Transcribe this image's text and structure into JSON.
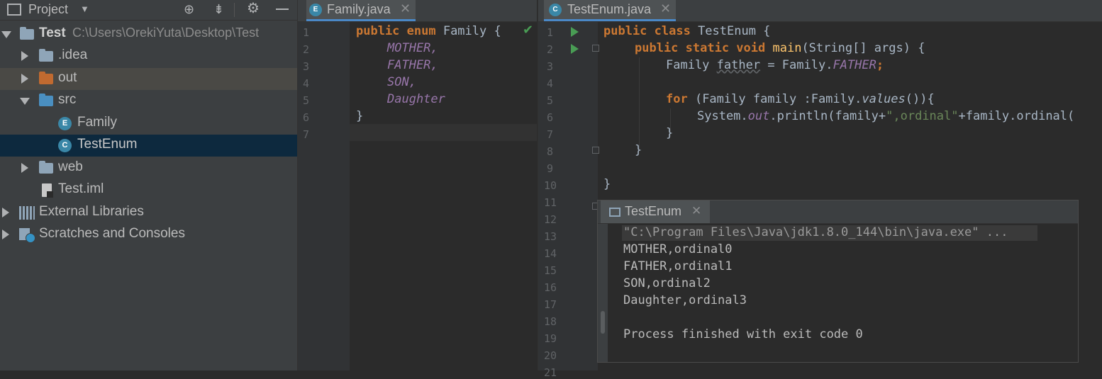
{
  "project": {
    "header_title": "Project",
    "tree": [
      {
        "label": "Test",
        "path": "C:\\Users\\OrekiYuta\\Desktop\\Test"
      },
      {
        "label": ".idea"
      },
      {
        "label": "out"
      },
      {
        "label": "src"
      },
      {
        "label": "Family"
      },
      {
        "label": "TestEnum"
      },
      {
        "label": "web"
      },
      {
        "label": "Test.iml"
      },
      {
        "label": "External Libraries"
      },
      {
        "label": "Scratches and Consoles"
      }
    ]
  },
  "editor_left": {
    "tab_label": "Family.java",
    "line_numbers": [
      "1",
      "2",
      "3",
      "4",
      "5",
      "6",
      "7"
    ],
    "code": {
      "l1_kw": "public enum",
      "l1_name": " Family {",
      "l2": "MOTHER,",
      "l3": "FATHER,",
      "l4": "SON,",
      "l5": "Daughter",
      "l6": "}"
    }
  },
  "editor_right": {
    "tab_label": "TestEnum.java",
    "line_numbers": [
      "1",
      "2",
      "3",
      "4",
      "5",
      "6",
      "7",
      "8",
      "9",
      "10",
      "11",
      "12",
      "13",
      "14",
      "15",
      "16",
      "17",
      "18",
      "19",
      "20",
      "21"
    ],
    "code": {
      "l1_kw": "public class",
      "l1_name": " TestEnum {",
      "l2_kw": "public static void",
      "l2_fn": "main",
      "l2_rest": "(String[] args) {",
      "l3_a": "Family ",
      "l3_var": "father",
      "l3_b": " = Family.",
      "l3_c": "FATHER",
      "l3_d": ";",
      "l5_kw": "for",
      "l5_a": " (Family family :Family.",
      "l5_b": "values",
      "l5_c": "()){",
      "l6_a": "System.",
      "l6_b": "out",
      "l6_c": ".println(family+",
      "l6_str": "\",ordinal\"",
      "l6_d": "+family.ordinal(",
      "l7": "}",
      "l8": "}",
      "l10": "}"
    }
  },
  "console": {
    "tab_label": "TestEnum",
    "lines": [
      "\"C:\\Program Files\\Java\\jdk1.8.0_144\\bin\\java.exe\" ...",
      "MOTHER,ordinal0",
      "FATHER,ordinal1",
      "SON,ordinal2",
      "Daughter,ordinal3",
      "",
      "Process finished with exit code 0"
    ]
  },
  "colors": {
    "keyword": "#cc7832",
    "constant": "#9876aa",
    "function": "#ffc66d",
    "string": "#6a8759",
    "run_icon": "#499c54",
    "selection": "#0d293e"
  }
}
